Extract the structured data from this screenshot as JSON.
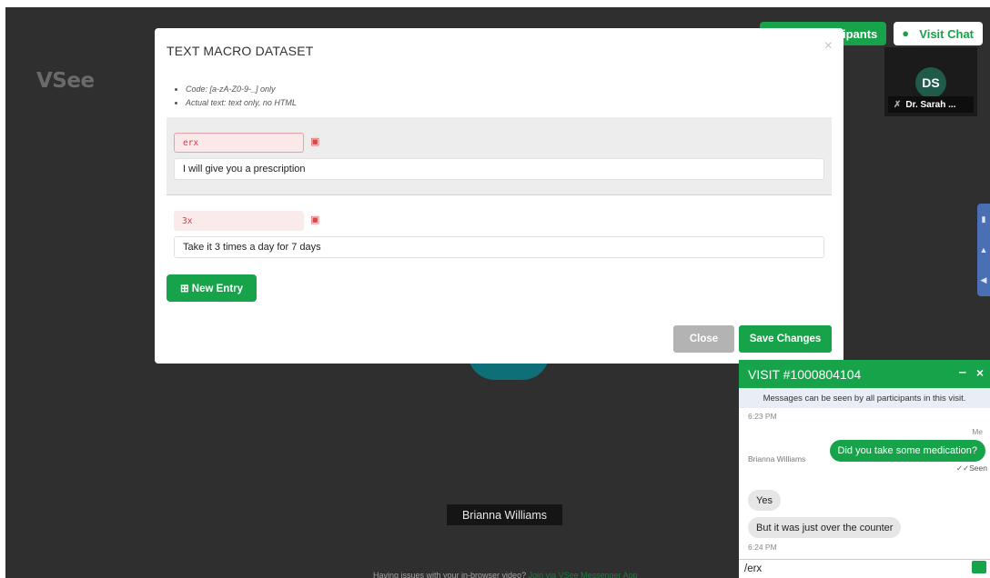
{
  "app": {
    "logo": "VSee",
    "participant_name": "Brianna Williams",
    "issue_text": "Having issues with your in-browser video?",
    "issue_link": "Join via VSee Messenger App"
  },
  "top_buttons": {
    "add_participants": "Add Participants",
    "visit_chat": "Visit Chat"
  },
  "tile": {
    "initials": "DS",
    "name": "Dr. Sarah ..."
  },
  "modal": {
    "title": "TEXT MACRO DATASET",
    "close_symbol": "×",
    "rules": [
      "Code: [a-zA-Z0-9-_] only",
      "Actual text: text only, no HTML"
    ],
    "entries": [
      {
        "code": "erx",
        "text": "I will give you a prescription"
      },
      {
        "code": "3x",
        "text": "Take it 3 times a day for 7 days"
      }
    ],
    "new_entry_label": "⊞ New Entry",
    "close_label": "Close",
    "save_label": "Save Changes"
  },
  "chat": {
    "title": "VISIT #1000804104",
    "minimize": "–",
    "close": "×",
    "notice": "Messages can be seen by all participants in this visit.",
    "time1": "6:23 PM",
    "me_label": "Me",
    "my_message": "Did you take some medication?",
    "seen": "✓✓Seen",
    "sender": "Brianna Williams",
    "reply1": "Yes",
    "reply2": "But it was just over the counter",
    "time2": "6:24 PM",
    "input_value": "/erx"
  },
  "colors": {
    "accent": "#16a34a",
    "stage_bg": "#2f2f2f",
    "side_tab": "#4a6fb5"
  }
}
